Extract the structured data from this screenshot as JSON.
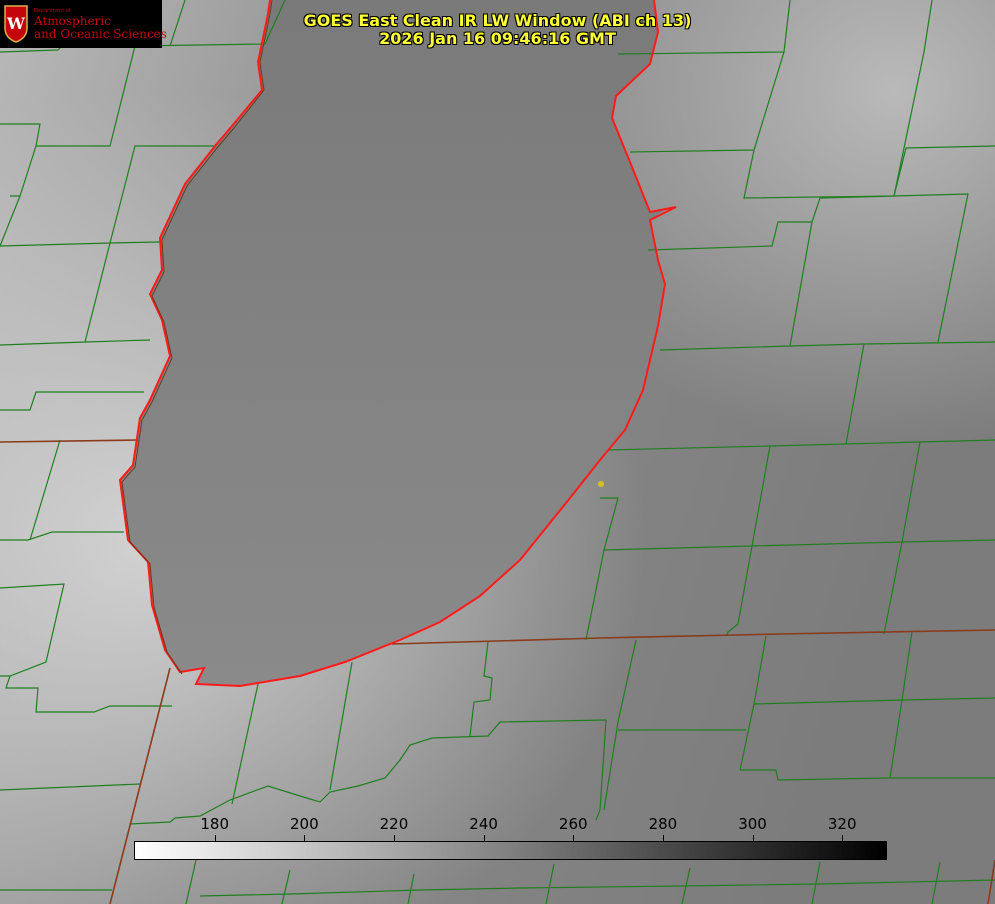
{
  "title": {
    "line1": "GOES East Clean IR LW Window (ABI ch 13)",
    "line2": "2026 Jan 16 09:46:16 GMT"
  },
  "logo": {
    "department": "Department of",
    "line1": "Atmospheric",
    "line2": "and Oceanic Sciences",
    "seal_letter": "W"
  },
  "colorbar": {
    "ticks": [
      "180",
      "200",
      "220",
      "240",
      "260",
      "280",
      "300",
      "320"
    ],
    "range": [
      162,
      330
    ],
    "colors": {
      "low": "#ffffff",
      "high": "#000000"
    }
  },
  "map": {
    "colors": {
      "county_lines": "#1f7f1f",
      "state_lines": "#8b3a1a",
      "coastline": "#ff1a1a",
      "marker": "#d4c21e"
    }
  }
}
